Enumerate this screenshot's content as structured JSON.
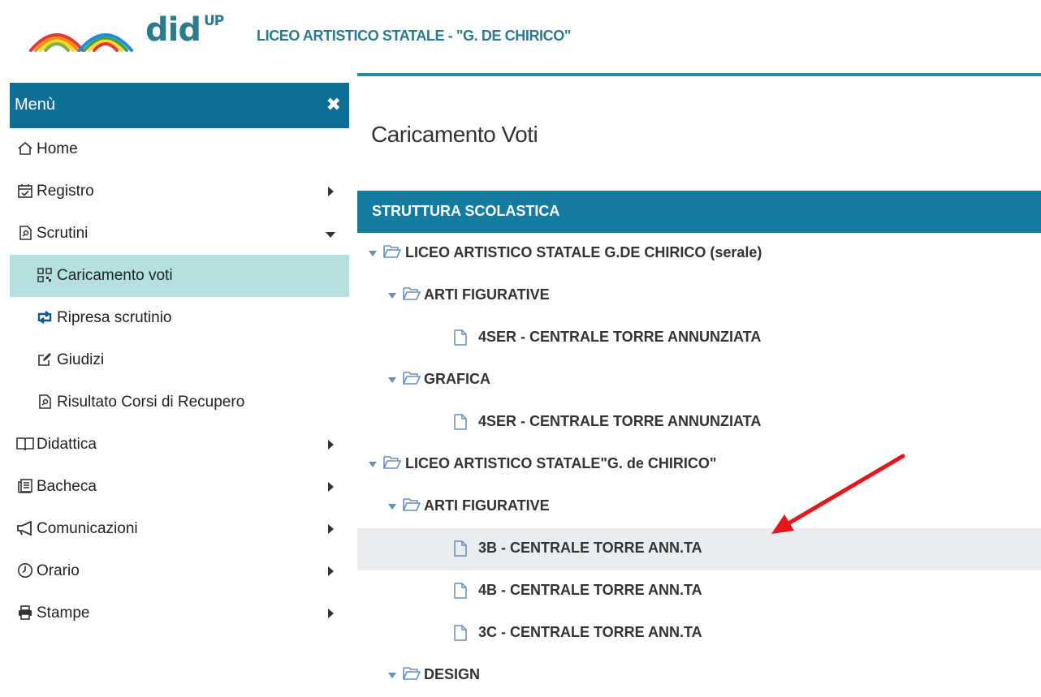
{
  "header": {
    "brand": "did",
    "brand_sup": "UP",
    "school_name": "LICEO ARTISTICO STATALE - \"G. DE CHIRICO\""
  },
  "sidebar": {
    "title": "Menù",
    "close_icon": "close-icon",
    "items": [
      {
        "label": "Home",
        "icon": "home-icon"
      },
      {
        "label": "Registro",
        "icon": "calendar-check-icon"
      },
      {
        "label": "Scrutini",
        "icon": "scrutini-icon"
      },
      {
        "label": "Caricamento voti",
        "icon": "qrcode-icon"
      },
      {
        "label": "Ripresa scrutinio",
        "icon": "retweet-icon"
      },
      {
        "label": "Giudizi",
        "icon": "edit-icon"
      },
      {
        "label": "Risultato Corsi di Recupero",
        "icon": "scrutini-icon"
      },
      {
        "label": "Didattica",
        "icon": "book-icon"
      },
      {
        "label": "Bacheca",
        "icon": "newspaper-icon"
      },
      {
        "label": "Comunicazioni",
        "icon": "megaphone-icon"
      },
      {
        "label": "Orario",
        "icon": "clock-icon"
      },
      {
        "label": "Stampe",
        "icon": "printer-icon"
      }
    ]
  },
  "main": {
    "page_title": "Caricamento Voti",
    "panel_title": "STRUTTURA SCOLASTICA",
    "tree": [
      {
        "label": "LICEO ARTISTICO STATALE G.DE CHIRICO (serale)",
        "type": "folder"
      },
      {
        "label": "ARTI FIGURATIVE",
        "type": "folder"
      },
      {
        "label": "4SER - CENTRALE TORRE ANNUNZIATA",
        "type": "class"
      },
      {
        "label": "GRAFICA",
        "type": "folder"
      },
      {
        "label": "4SER - CENTRALE TORRE ANNUNZIATA",
        "type": "class"
      },
      {
        "label": "LICEO ARTISTICO STATALE\"G. de CHIRICO\"",
        "type": "folder"
      },
      {
        "label": "ARTI FIGURATIVE",
        "type": "folder"
      },
      {
        "label": "3B - CENTRALE TORRE ANN.TA",
        "type": "class",
        "highlighted": true
      },
      {
        "label": "4B - CENTRALE TORRE ANN.TA",
        "type": "class"
      },
      {
        "label": "3C - CENTRALE TORRE ANN.TA",
        "type": "class"
      },
      {
        "label": "DESIGN",
        "type": "folder"
      }
    ]
  },
  "colors": {
    "accent": "#147ca0",
    "menu_header": "#0d6f94",
    "active_item": "#b4e0e0",
    "brand": "#2c7b8c",
    "annotation_arrow": "#e8141b"
  }
}
